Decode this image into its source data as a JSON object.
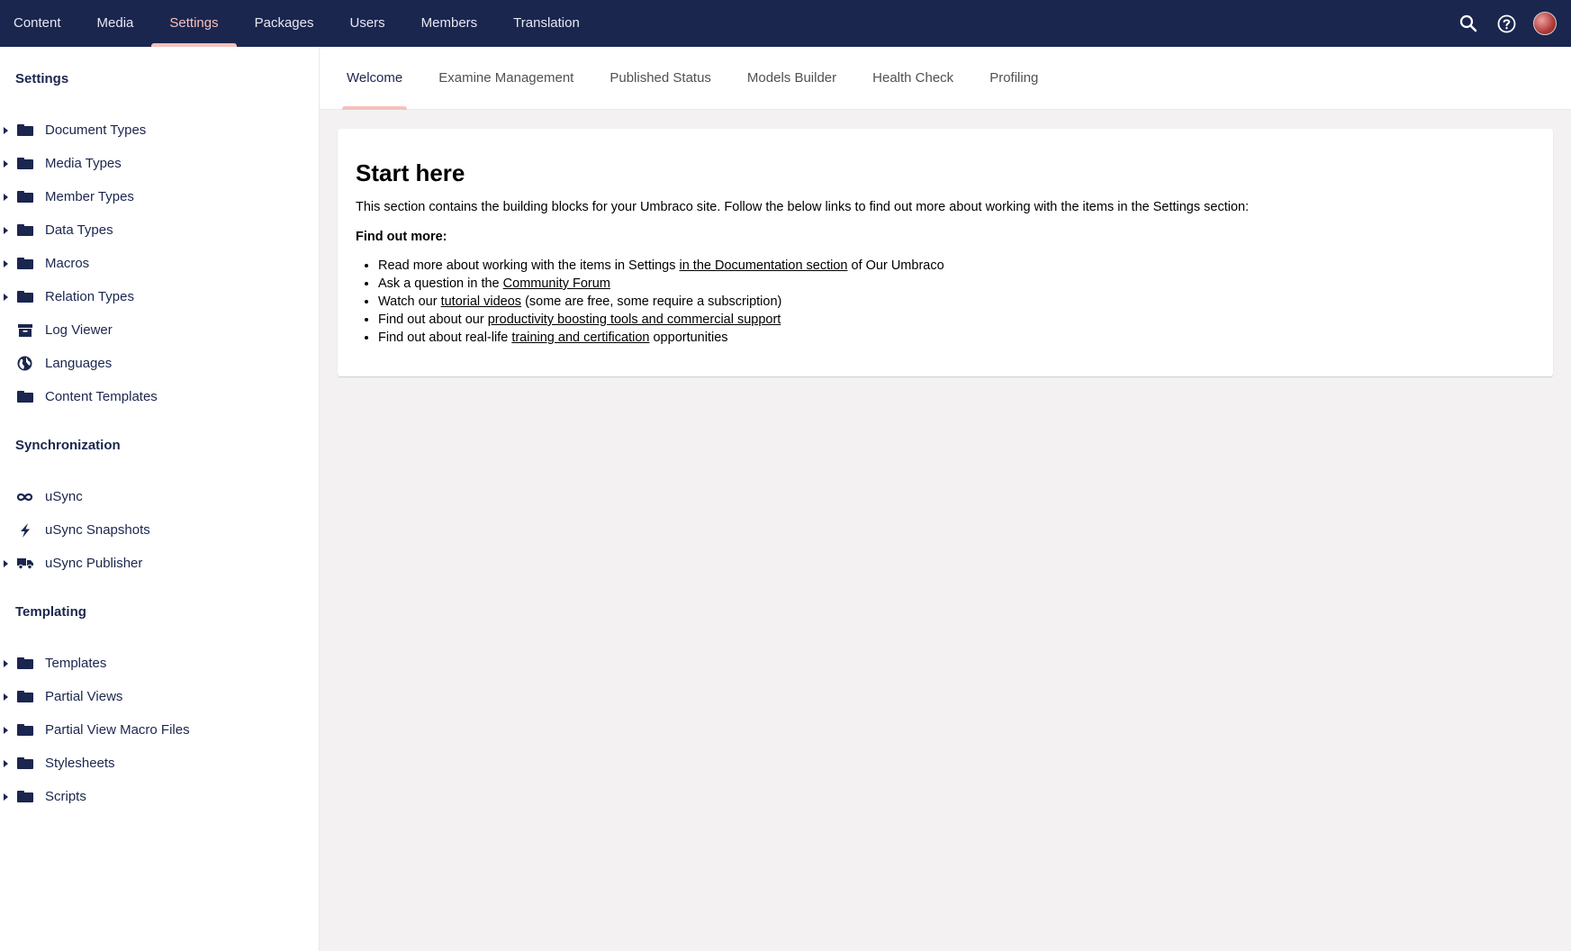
{
  "topnav": {
    "items": [
      {
        "label": "Content"
      },
      {
        "label": "Media"
      },
      {
        "label": "Settings"
      },
      {
        "label": "Packages"
      },
      {
        "label": "Users"
      },
      {
        "label": "Members"
      },
      {
        "label": "Translation"
      }
    ],
    "active_index": 2,
    "icons": [
      "search-icon",
      "help-icon",
      "avatar"
    ]
  },
  "sidebar": {
    "settings": {
      "heading": "Settings",
      "items": [
        {
          "label": "Document Types",
          "icon": "folder-icon",
          "expandable": true
        },
        {
          "label": "Media Types",
          "icon": "folder-icon",
          "expandable": true
        },
        {
          "label": "Member Types",
          "icon": "folder-icon",
          "expandable": true
        },
        {
          "label": "Data Types",
          "icon": "folder-icon",
          "expandable": true
        },
        {
          "label": "Macros",
          "icon": "folder-icon",
          "expandable": true
        },
        {
          "label": "Relation Types",
          "icon": "folder-icon",
          "expandable": true
        },
        {
          "label": "Log Viewer",
          "icon": "archive-icon",
          "expandable": false
        },
        {
          "label": "Languages",
          "icon": "globe-icon",
          "expandable": false
        },
        {
          "label": "Content Templates",
          "icon": "folder-icon",
          "expandable": false
        }
      ]
    },
    "synchronization": {
      "heading": "Synchronization",
      "items": [
        {
          "label": "uSync",
          "icon": "infinity-icon",
          "expandable": false
        },
        {
          "label": "uSync Snapshots",
          "icon": "lightning-icon",
          "expandable": false
        },
        {
          "label": "uSync Publisher",
          "icon": "truck-icon",
          "expandable": true
        }
      ]
    },
    "templating": {
      "heading": "Templating",
      "items": [
        {
          "label": "Templates",
          "icon": "folder-icon",
          "expandable": true
        },
        {
          "label": "Partial Views",
          "icon": "folder-icon",
          "expandable": true
        },
        {
          "label": "Partial View Macro Files",
          "icon": "folder-icon",
          "expandable": true
        },
        {
          "label": "Stylesheets",
          "icon": "folder-icon",
          "expandable": true
        },
        {
          "label": "Scripts",
          "icon": "folder-icon",
          "expandable": true
        }
      ]
    }
  },
  "tabs": {
    "items": [
      {
        "label": "Welcome"
      },
      {
        "label": "Examine Management"
      },
      {
        "label": "Published Status"
      },
      {
        "label": "Models Builder"
      },
      {
        "label": "Health Check"
      },
      {
        "label": "Profiling"
      }
    ],
    "active_index": 0
  },
  "welcome": {
    "title": "Start here",
    "intro": "This section contains the building blocks for your Umbraco site. Follow the below links to find out more about working with the items in the Settings section:",
    "find_out_more": "Find out more:",
    "links": [
      {
        "before": "Read more about working with the items in Settings ",
        "link": "in the Documentation section",
        "after": " of Our Umbraco"
      },
      {
        "before": "Ask a question in the ",
        "link": "Community Forum",
        "after": ""
      },
      {
        "before": "Watch our ",
        "link": "tutorial videos",
        "after": " (some are free, some require a subscription)"
      },
      {
        "before": "Find out about our ",
        "link": "productivity boosting tools and commercial support",
        "after": ""
      },
      {
        "before": "Find out about real-life ",
        "link": "training and certification",
        "after": " opportunities"
      }
    ]
  },
  "colors": {
    "header_bg": "#1b264f",
    "accent": "#f5c1bc",
    "page_bg": "#f3f1f1"
  }
}
